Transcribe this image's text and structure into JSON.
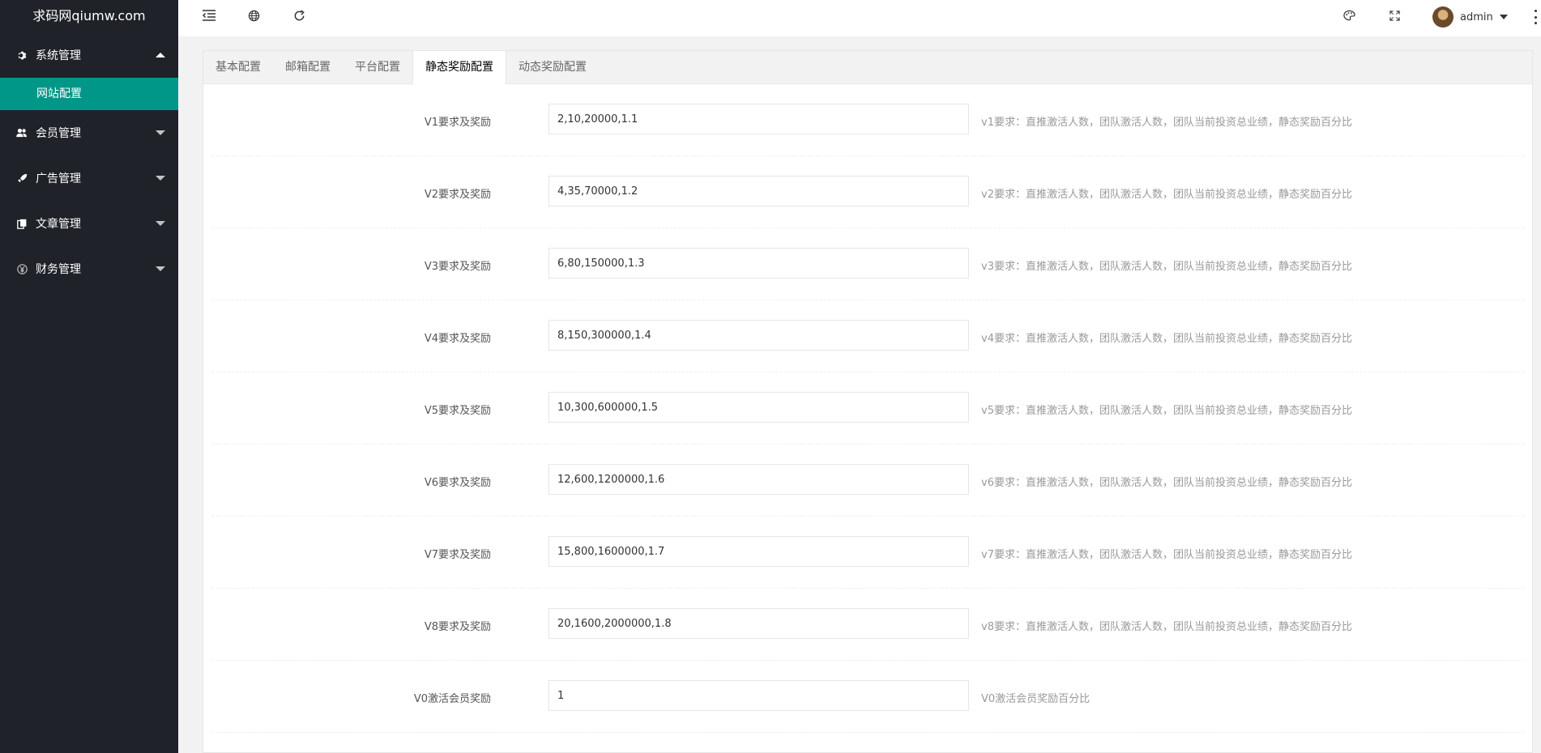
{
  "sidebar": {
    "logo": "求码网qiumw.com",
    "groups": [
      {
        "label": "系统管理",
        "icon": "gear-icon",
        "expanded": true,
        "sub": [
          "网站配置"
        ]
      },
      {
        "label": "会员管理",
        "icon": "users-icon"
      },
      {
        "label": "广告管理",
        "icon": "rocket-icon"
      },
      {
        "label": "文章管理",
        "icon": "document-icon"
      },
      {
        "label": "财务管理",
        "icon": "yen-icon"
      }
    ]
  },
  "header": {
    "icons": [
      "menu-collapse-icon",
      "globe-icon",
      "refresh-icon",
      "theme-icon",
      "fullscreen-icon",
      "more-icon"
    ],
    "username": "admin"
  },
  "tabs": [
    "基本配置",
    "邮箱配置",
    "平台配置",
    "静态奖励配置",
    "动态奖励配置"
  ],
  "active_tab": "静态奖励配置",
  "form": {
    "rows": [
      {
        "label": "V1要求及奖励",
        "value": "2,10,20000,1.1",
        "hint": "v1要求：直推激活人数，团队激活人数，团队当前投资总业绩，静态奖励百分比"
      },
      {
        "label": "V2要求及奖励",
        "value": "4,35,70000,1.2",
        "hint": "v2要求：直推激活人数，团队激活人数，团队当前投资总业绩，静态奖励百分比"
      },
      {
        "label": "V3要求及奖励",
        "value": "6,80,150000,1.3",
        "hint": "v3要求：直推激活人数，团队激活人数，团队当前投资总业绩，静态奖励百分比"
      },
      {
        "label": "V4要求及奖励",
        "value": "8,150,300000,1.4",
        "hint": "v4要求：直推激活人数，团队激活人数，团队当前投资总业绩，静态奖励百分比"
      },
      {
        "label": "V5要求及奖励",
        "value": "10,300,600000,1.5",
        "hint": "v5要求：直推激活人数，团队激活人数，团队当前投资总业绩，静态奖励百分比"
      },
      {
        "label": "V6要求及奖励",
        "value": "12,600,1200000,1.6",
        "hint": "v6要求：直推激活人数，团队激活人数，团队当前投资总业绩，静态奖励百分比"
      },
      {
        "label": "V7要求及奖励",
        "value": "15,800,1600000,1.7",
        "hint": "v7要求：直推激活人数，团队激活人数，团队当前投资总业绩，静态奖励百分比"
      },
      {
        "label": "V8要求及奖励",
        "value": "20,1600,2000000,1.8",
        "hint": "v8要求：直推激活人数，团队激活人数，团队当前投资总业绩，静态奖励百分比"
      },
      {
        "label": "V0激活会员奖励",
        "value": "1",
        "hint": "V0激活会员奖励百分比"
      }
    ]
  },
  "colors": {
    "sidebar_bg": "#20222a",
    "active_sub_bg": "#009688"
  }
}
